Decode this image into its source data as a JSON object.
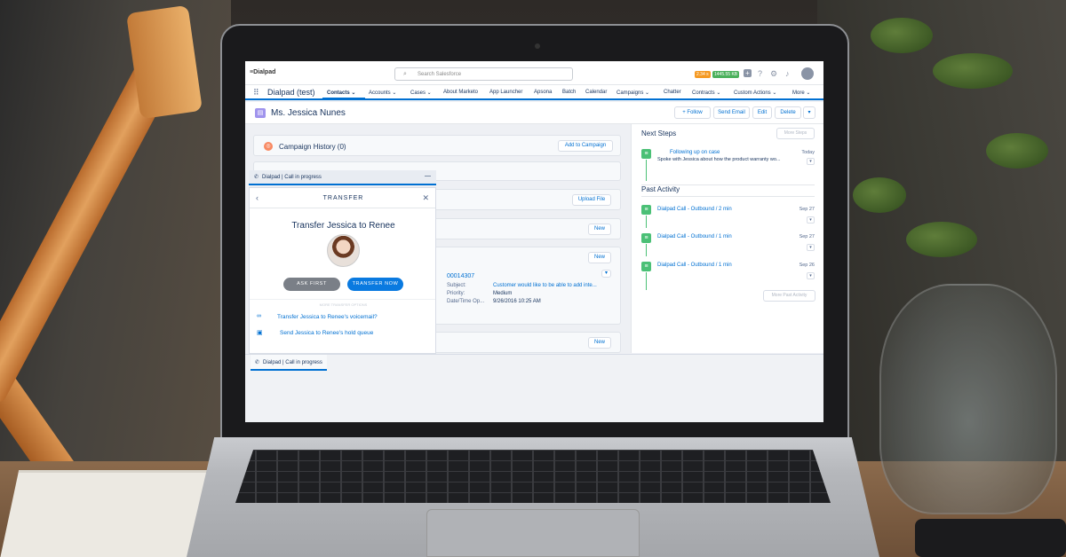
{
  "topbar": {
    "logo": "≡Dialpad",
    "search_placeholder": "Search Salesforce",
    "badge_orange": "2.34 s",
    "badge_green": "1445.55 KB",
    "icons": [
      "add-icon",
      "help-icon",
      "gear-icon",
      "bell-icon",
      "avatar"
    ]
  },
  "navbar": {
    "app_name": "Dialpad (test)",
    "items": [
      {
        "label": "Contacts ⌄"
      },
      {
        "label": "Accounts ⌄"
      },
      {
        "label": "Cases ⌄"
      },
      {
        "label": "About Marketo"
      },
      {
        "label": "App Launcher"
      },
      {
        "label": "Apsona"
      },
      {
        "label": "Batch"
      },
      {
        "label": "Calendar"
      },
      {
        "label": "Campaigns ⌄"
      },
      {
        "label": "Chatter"
      },
      {
        "label": "Contracts ⌄"
      },
      {
        "label": "Custom Actions ⌄"
      },
      {
        "label": "More ⌄"
      }
    ]
  },
  "record": {
    "title": "Ms. Jessica Nunes",
    "follow": "+ Follow",
    "send_email": "Send Email",
    "edit": "Edit",
    "delete": "Delete",
    "more_arrow": "▾"
  },
  "related": {
    "campaign_history": "Campaign History (0)",
    "add_to_campaign": "Add to Campaign",
    "upload_file": "Upload File",
    "new_label": "New",
    "case": {
      "number": "00014307",
      "subject_label": "Subject:",
      "subject_value": "Customer would like to be able to add inte...",
      "priority_label": "Priority:",
      "priority_value": "Medium",
      "date_label": "Date/Time Op...",
      "date_value": "9/26/2016 10:25 AM"
    }
  },
  "activity": {
    "next_steps": "Next Steps",
    "more_steps": "More Steps",
    "next_item": {
      "title": "Following up on case",
      "date": "Today",
      "desc": "Spoke with Jessica about how the product warranty wo..."
    },
    "past_activity": "Past Activity",
    "past_items": [
      {
        "title": "Dialpad Call - Outbound / 2 min",
        "date": "Sep 27"
      },
      {
        "title": "Dialpad Call - Outbound / 1 min",
        "date": "Sep 27"
      },
      {
        "title": "Dialpad Call - Outbound / 1 min",
        "date": "Sep 26"
      }
    ],
    "more_past": "More Past Activity"
  },
  "dialpad": {
    "header": "Dialpad | Call in progress",
    "minimize": "—",
    "transfer_title": "TRANSFER",
    "back": "‹",
    "close": "✕",
    "main_text": "Transfer Jessica to Renee",
    "ask_first": "ASK FIRST",
    "transfer_now": "TRANSFER NOW",
    "faint_label": "MORE TRANSFER OPTIONS",
    "voicemail_option": "Transfer Jessica to Renee's voicemail?",
    "hold_option": "Send Jessica to Renee's hold queue",
    "tab_label": "Dialpad | Call in progress"
  },
  "colors": {
    "accent": "#0070d2",
    "activity_green": "#4bc076",
    "record_icon": "#a094ed",
    "campaign_icon": "#f88962"
  }
}
